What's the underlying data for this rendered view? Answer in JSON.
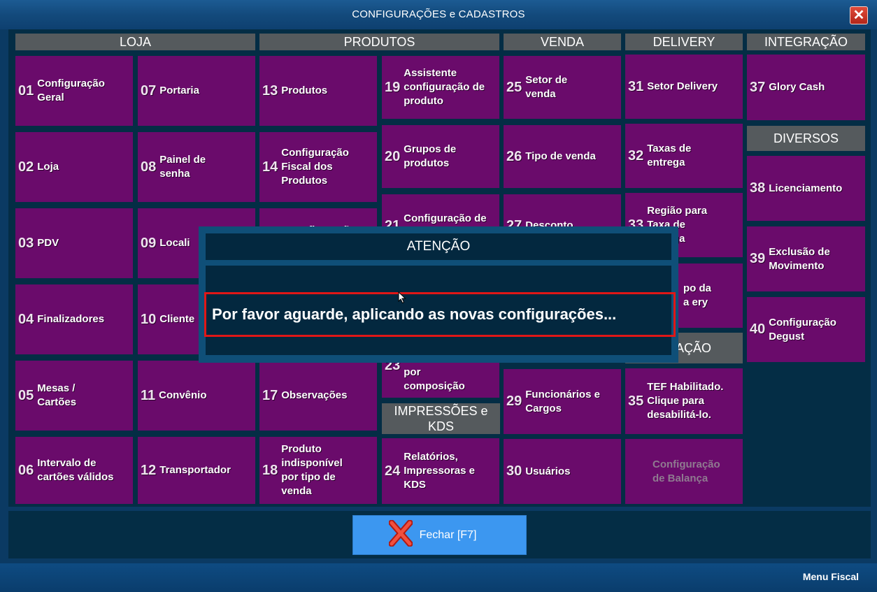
{
  "window": {
    "title": "CONFIGURAÇÕES e CADASTROS",
    "close_label": "✕"
  },
  "sections": {
    "loja": "LOJA",
    "produtos": "PRODUTOS",
    "venda": "VENDA",
    "delivery": "DELIVERY",
    "integracao": "INTEGRAÇÃO",
    "diversos": "DIVERSOS",
    "impressoes": "IMPRESSÕES e KDS",
    "integracao2": "GRAÇÃO"
  },
  "tiles": {
    "t01": {
      "num": "01",
      "label": "Configuração Geral"
    },
    "t02": {
      "num": "02",
      "label": "Loja"
    },
    "t03": {
      "num": "03",
      "label": "PDV"
    },
    "t04": {
      "num": "04",
      "label": "Finalizadores"
    },
    "t05": {
      "num": "05",
      "label": "Mesas / Cartões"
    },
    "t06": {
      "num": "06",
      "label": "Intervalo de cartões válidos"
    },
    "t07": {
      "num": "07",
      "label": "Portaria"
    },
    "t08": {
      "num": "08",
      "label": "Painel de senha"
    },
    "t09": {
      "num": "09",
      "label": "Locali"
    },
    "t10": {
      "num": "10",
      "label": "Cliente"
    },
    "t11": {
      "num": "11",
      "label": "Convênio"
    },
    "t12": {
      "num": "12",
      "label": "Transportador"
    },
    "t13": {
      "num": "13",
      "label": "Produtos"
    },
    "t14": {
      "num": "14",
      "label": "Configuração Fiscal dos Produtos"
    },
    "t15": {
      "num": "",
      "label": "Configuraçã"
    },
    "t17": {
      "num": "17",
      "label": "Observações"
    },
    "t18": {
      "num": "18",
      "label": "Produto indisponível por tipo de venda"
    },
    "t19": {
      "num": "19",
      "label": "Assistente configuração de produto"
    },
    "t20": {
      "num": "20",
      "label": "Grupos de produtos"
    },
    "t21": {
      "num": "21",
      "label": "Configuração de Grupos de"
    },
    "t23": {
      "num": "23",
      "label": "por composição"
    },
    "t24": {
      "num": "24",
      "label": "Relatórios, Impressoras e KDS"
    },
    "t25": {
      "num": "25",
      "label": "Setor de venda"
    },
    "t26": {
      "num": "26",
      "label": "Tipo de venda"
    },
    "t27": {
      "num": "27",
      "label": "Desconto"
    },
    "t29": {
      "num": "29",
      "label": "Funcionários e Cargos"
    },
    "t30": {
      "num": "30",
      "label": "Usuários"
    },
    "t31": {
      "num": "31",
      "label": "Setor Delivery"
    },
    "t32": {
      "num": "32",
      "label": "Taxas de entrega"
    },
    "t33": {
      "num": "33",
      "label": "Região para Taxa de entrega"
    },
    "t34": {
      "num": "",
      "label": "po da a ery"
    },
    "t35": {
      "num": "35",
      "label": "TEF Habilitado. Clique para desabilitá-lo."
    },
    "tbal": {
      "num": "",
      "label": "Configuração de Balança"
    },
    "t37": {
      "num": "37",
      "label": "Glory Cash"
    },
    "t38": {
      "num": "38",
      "label": "Licenciamento"
    },
    "t39": {
      "num": "39",
      "label": "Exclusão de Movimento"
    },
    "t40": {
      "num": "40",
      "label": "Configuração Degust"
    }
  },
  "footer": {
    "fechar_label": "Fechar [F7]"
  },
  "statusbar": {
    "menu_label": "Menu Fiscal"
  },
  "modal": {
    "title": "ATENÇÃO",
    "message": "Por favor aguarde, aplicando as novas configurações..."
  },
  "colors": {
    "tile": "#6a0b6b",
    "header": "#555a5d",
    "background": "#042d45",
    "button": "#3c97f0",
    "highlight_border": "#e01717"
  }
}
